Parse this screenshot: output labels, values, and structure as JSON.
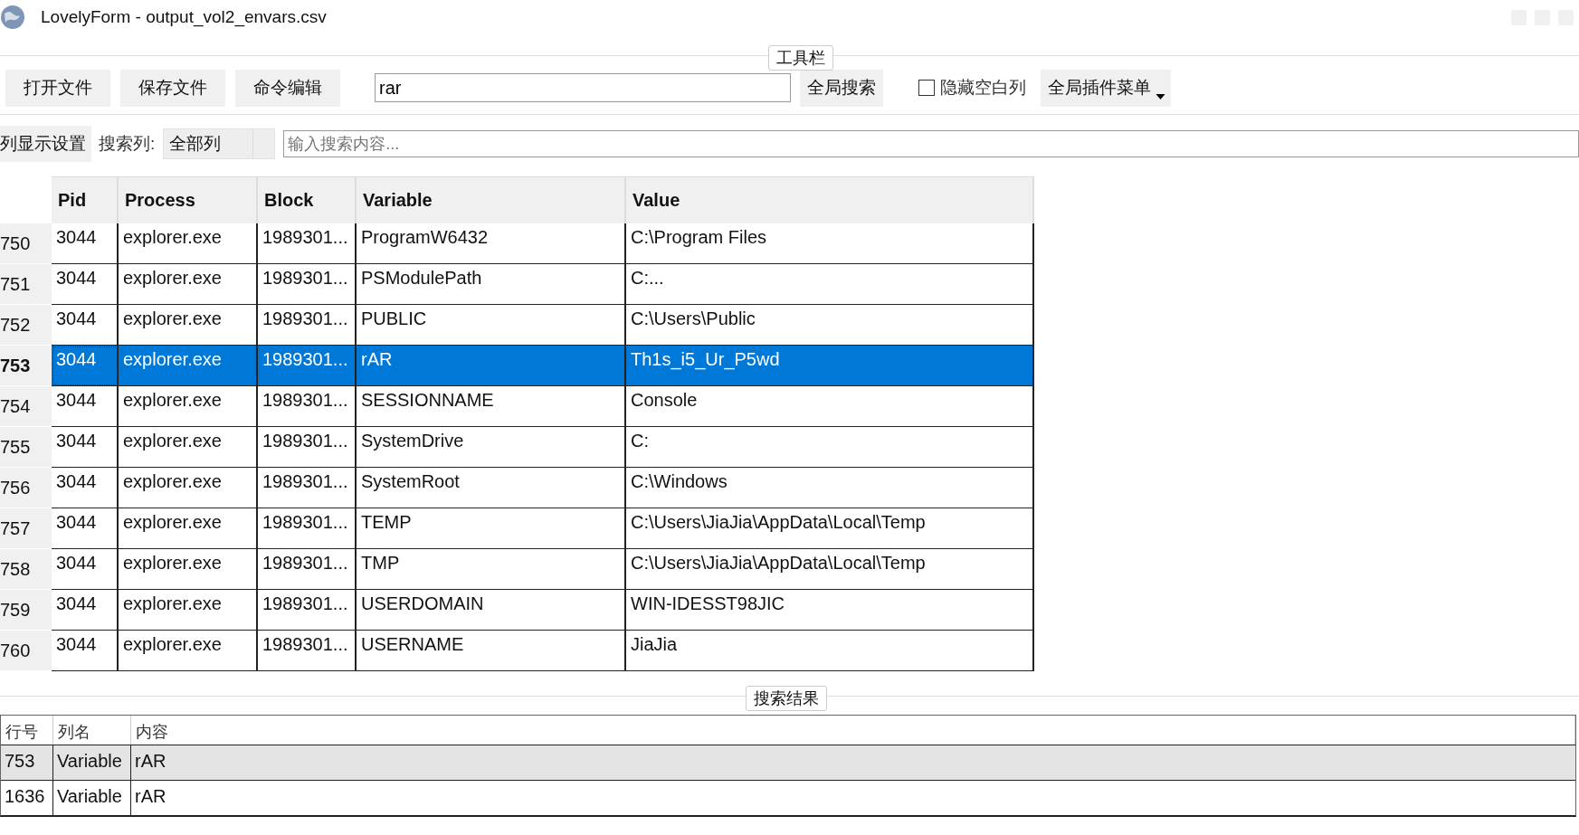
{
  "window": {
    "title": "LovelyForm - output_vol2_envars.csv"
  },
  "toolbar": {
    "title": "工具栏",
    "buttons": [
      "打开文件",
      "保存文件",
      "命令编辑"
    ],
    "search_value": "rar",
    "search_button": "全局搜索",
    "hide_empty": {
      "label": "隐藏空白列",
      "checked": false
    },
    "plugin_menu": "全局插件菜单"
  },
  "filter_bar": {
    "column_settings": "列显示设置",
    "search_column_label": "搜索列:",
    "search_column": "全部列",
    "search": {
      "placeholder": "输入搜索内容..."
    }
  },
  "table": {
    "columns": [
      "Pid",
      "Process",
      "Block",
      "Variable",
      "Value"
    ],
    "rows": [
      {
        "index": "750",
        "cells": [
          "3044",
          "explorer.exe",
          "1989301...",
          "ProgramW6432",
          "C:\\Program Files"
        ],
        "selected": false
      },
      {
        "index": "751",
        "cells": [
          "3044",
          "explorer.exe",
          "1989301...",
          "PSModulePath",
          "C:..."
        ],
        "selected": false
      },
      {
        "index": "752",
        "cells": [
          "3044",
          "explorer.exe",
          "1989301...",
          "PUBLIC",
          "C:\\Users\\Public"
        ],
        "selected": false
      },
      {
        "index": "753",
        "cells": [
          "3044",
          "explorer.exe",
          "1989301...",
          "rAR",
          "Th1s_i5_Ur_P5wd"
        ],
        "selected": true
      },
      {
        "index": "754",
        "cells": [
          "3044",
          "explorer.exe",
          "1989301...",
          "SESSIONNAME",
          "Console"
        ],
        "selected": false
      },
      {
        "index": "755",
        "cells": [
          "3044",
          "explorer.exe",
          "1989301...",
          "SystemDrive",
          "C:"
        ],
        "selected": false
      },
      {
        "index": "756",
        "cells": [
          "3044",
          "explorer.exe",
          "1989301...",
          "SystemRoot",
          "C:\\Windows"
        ],
        "selected": false
      },
      {
        "index": "757",
        "cells": [
          "3044",
          "explorer.exe",
          "1989301...",
          "TEMP",
          "C:\\Users\\JiaJia\\AppData\\Local\\Temp"
        ],
        "selected": false
      },
      {
        "index": "758",
        "cells": [
          "3044",
          "explorer.exe",
          "1989301...",
          "TMP",
          "C:\\Users\\JiaJia\\AppData\\Local\\Temp"
        ],
        "selected": false
      },
      {
        "index": "759",
        "cells": [
          "3044",
          "explorer.exe",
          "1989301...",
          "USERDOMAIN",
          "WIN-IDESST98JIC"
        ],
        "selected": false
      },
      {
        "index": "760",
        "cells": [
          "3044",
          "explorer.exe",
          "1989301...",
          "USERNAME",
          "JiaJia"
        ],
        "selected": false
      }
    ]
  },
  "results": {
    "title": "搜索结果",
    "columns": [
      "行号",
      "列名",
      "内容"
    ],
    "rows": [
      {
        "cells": [
          "753",
          "Variable",
          "rAR"
        ],
        "selected": true
      },
      {
        "cells": [
          "1636",
          "Variable",
          "rAR"
        ],
        "selected": false
      }
    ]
  }
}
